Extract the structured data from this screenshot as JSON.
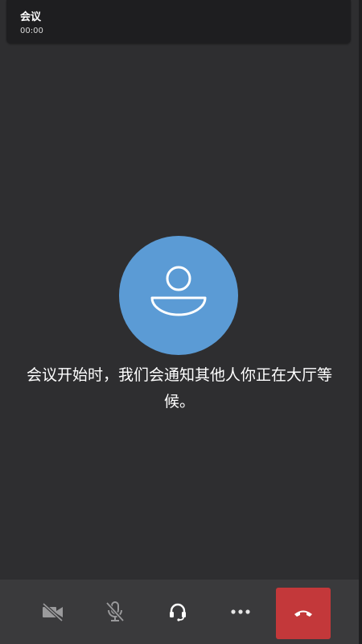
{
  "header": {
    "title": "会议",
    "timer": "00:00"
  },
  "main": {
    "avatar_icon": "person-icon",
    "avatar_color": "#5b9bd5",
    "waiting_message": "会议开始时，我们会通知其他人你正在大厅等候。"
  },
  "toolbar": {
    "buttons": [
      {
        "icon": "video-off-icon",
        "state": "off"
      },
      {
        "icon": "mic-off-icon",
        "state": "off"
      },
      {
        "icon": "headset-icon",
        "state": "on"
      },
      {
        "icon": "more-icon"
      },
      {
        "icon": "hang-up-icon",
        "color": "#c3383a"
      }
    ]
  }
}
